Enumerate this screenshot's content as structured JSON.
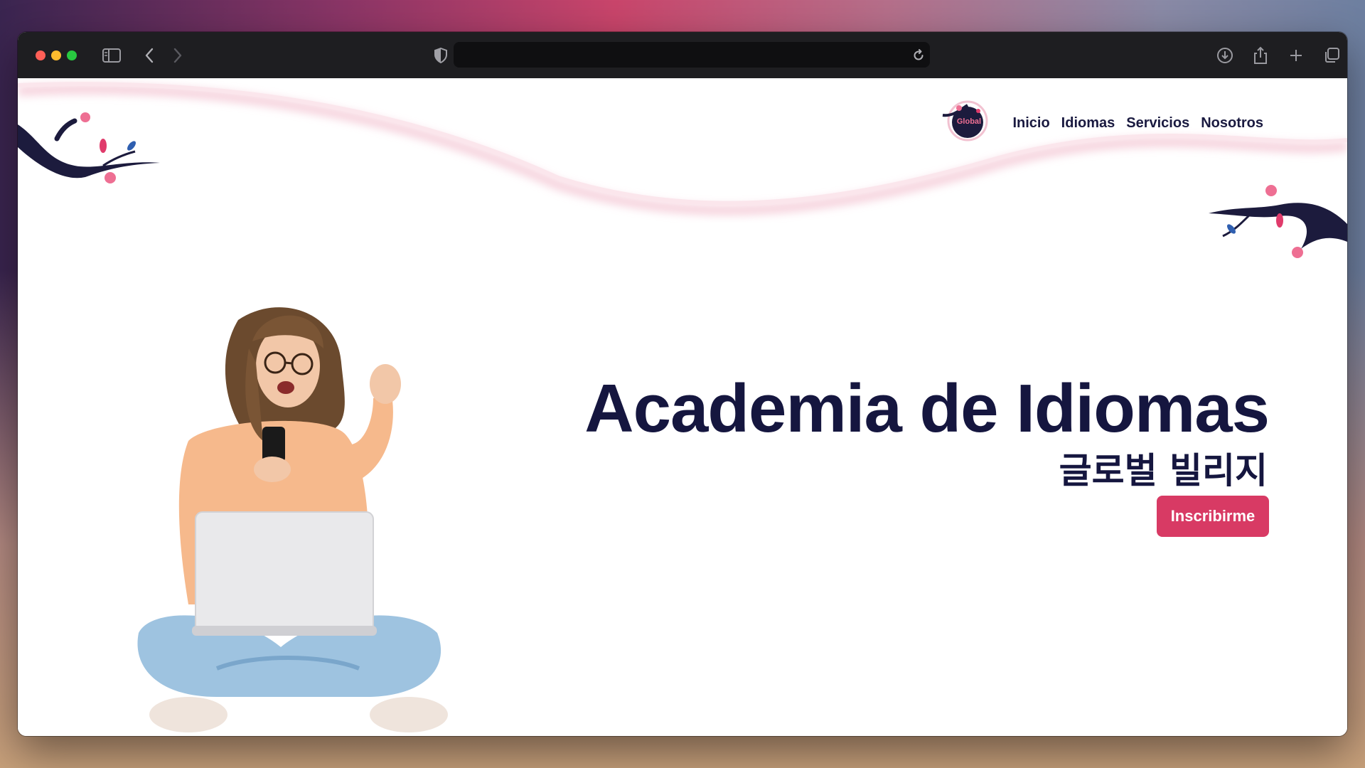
{
  "browser": {
    "traffic_lights": {
      "close": "#ff5f57",
      "minimize": "#febc2e",
      "maximize": "#28c840"
    },
    "address_value": "",
    "icons": [
      "sidebar-toggle-icon",
      "back-icon",
      "forward-icon",
      "privacy-shield-icon",
      "reload-icon",
      "download-icon",
      "share-icon",
      "new-tab-icon",
      "tab-overview-icon"
    ]
  },
  "site": {
    "logo_text": "Global",
    "nav": [
      "Inicio",
      "Idiomas",
      "Servicios",
      "Nosotros"
    ]
  },
  "hero": {
    "title": "Academia de Idiomas",
    "subtitle": "글로벌 빌리지",
    "cta_label": "Inscribirme"
  },
  "colors": {
    "navy": "#15163f",
    "accent": "#d83a64",
    "blossom": "#ee6f93",
    "wave_pink": "#f7d6e0"
  }
}
